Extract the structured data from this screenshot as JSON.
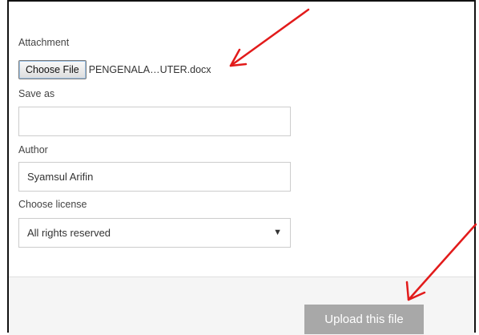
{
  "form": {
    "attachment_label": "Attachment",
    "choose_file_label": "Choose File",
    "selected_file_name": "PENGENALA…UTER.docx",
    "save_as_label": "Save as",
    "save_as_value": "",
    "author_label": "Author",
    "author_value": "Syamsul Arifin",
    "license_label": "Choose license",
    "license_selected": "All rights reserved"
  },
  "footer": {
    "upload_label": "Upload this file"
  },
  "annotations": {
    "arrow_color": "#e21b1b"
  },
  "icons": {
    "select_arrow": "chevron-down-icon"
  }
}
